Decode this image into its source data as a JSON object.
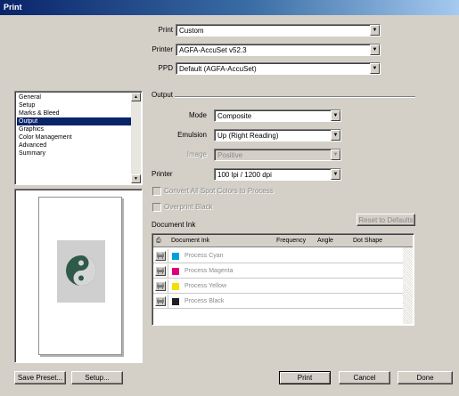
{
  "window": {
    "title": "Print"
  },
  "form": {
    "print_label": "Print",
    "print_value": "Custom",
    "printer_label": "Printer",
    "printer_value": "AGFA-AccuSet v52.3",
    "ppd_label": "PPD",
    "ppd_value": "Default (AGFA-AccuSet)"
  },
  "categories": {
    "items": [
      "General",
      "Setup",
      "Marks & Bleed",
      "Output",
      "Graphics",
      "Color Management",
      "Advanced",
      "Summary"
    ],
    "selected": "Output"
  },
  "output": {
    "title": "Output",
    "mode_label": "Mode",
    "mode_value": "Composite",
    "emulsion_label": "Emulsion",
    "emulsion_value": "Up (Right Reading)",
    "image_label": "Image",
    "image_value": "Positive",
    "printer_res_label": "Printer",
    "printer_res_value": "100 lpi / 1200 dpi",
    "checkbox_spot": "Convert All Spot Colors to Process",
    "checkbox_overprint": "Overprint Black"
  },
  "ink": {
    "title": "Document Ink",
    "reset_label": "Reset to Defaults",
    "columns": [
      "Document Ink",
      "Frequency",
      "Angle",
      "Dot Shape"
    ],
    "rows": [
      {
        "name": "Process Cyan",
        "color": "#00a0e0"
      },
      {
        "name": "Process Magenta",
        "color": "#e0007a"
      },
      {
        "name": "Process Yellow",
        "color": "#f0e000"
      },
      {
        "name": "Process Black",
        "color": "#202020"
      }
    ]
  },
  "buttons": {
    "save_preset": "Save Preset...",
    "setup": "Setup...",
    "print": "Print",
    "cancel": "Cancel",
    "done": "Done"
  },
  "colors": {
    "titlebar": "#0a246a",
    "dialog": "#d4d0c8",
    "selection": "#0a246a",
    "preview_symbol": "#2f5a4a"
  }
}
